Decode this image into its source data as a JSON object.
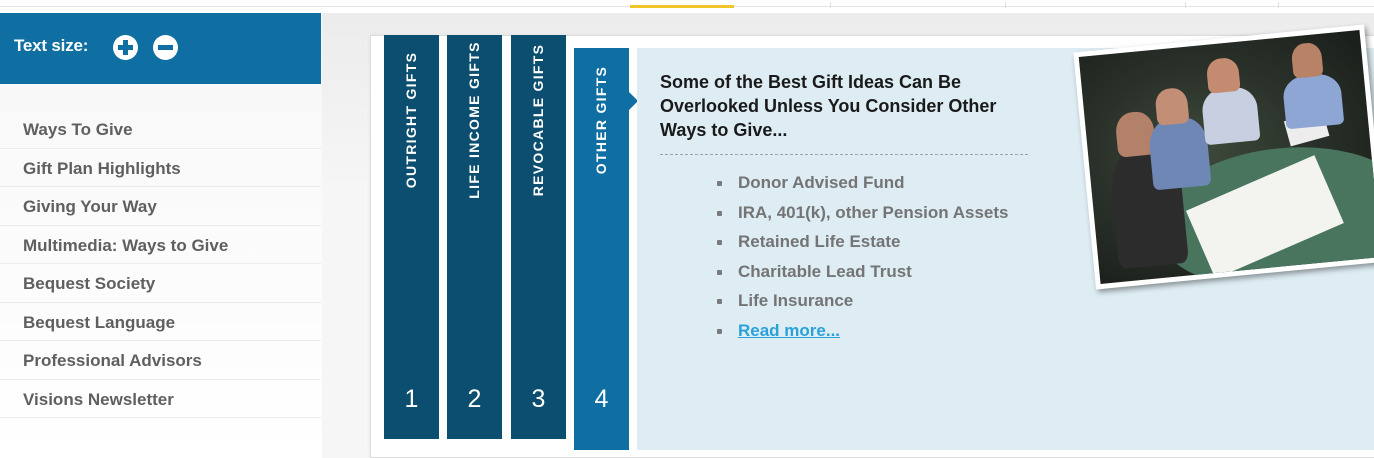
{
  "text_size": {
    "label": "Text size:"
  },
  "nav": [
    {
      "label": "Ways To Give"
    },
    {
      "label": "Gift Plan Highlights"
    },
    {
      "label": "Giving Your Way"
    },
    {
      "label": "Multimedia: Ways to Give"
    },
    {
      "label": "Bequest Society"
    },
    {
      "label": "Bequest Language"
    },
    {
      "label": "Professional Advisors"
    },
    {
      "label": "Visions Newsletter"
    }
  ],
  "tabs": [
    {
      "label": "OUTRIGHT GIFTS",
      "number": "1",
      "active": false
    },
    {
      "label": "LIFE INCOME GIFTS",
      "number": "2",
      "active": false
    },
    {
      "label": "REVOCABLE GIFTS",
      "number": "3",
      "active": false
    },
    {
      "label": "OTHER GIFTS",
      "number": "4",
      "active": true
    }
  ],
  "content": {
    "headline": "Some of the Best Gift Ideas Can Be Overlooked Unless You Consider Other Ways to Give...",
    "bullets": [
      "Donor Advised Fund",
      "IRA, 401(k), other Pension Assets",
      "Retained Life Estate",
      "Charitable Lead Trust",
      "Life Insurance"
    ],
    "read_more": "Read more..."
  },
  "colors": {
    "brand_blue": "#0f6fa2",
    "tab_dark": "#0b4e6f",
    "panel_bg": "#deedf4",
    "link": "#2aa1d8",
    "accent_yellow": "#f2c62b"
  },
  "icons": {
    "increase_text": "plus-circle-icon",
    "decrease_text": "minus-circle-icon"
  }
}
